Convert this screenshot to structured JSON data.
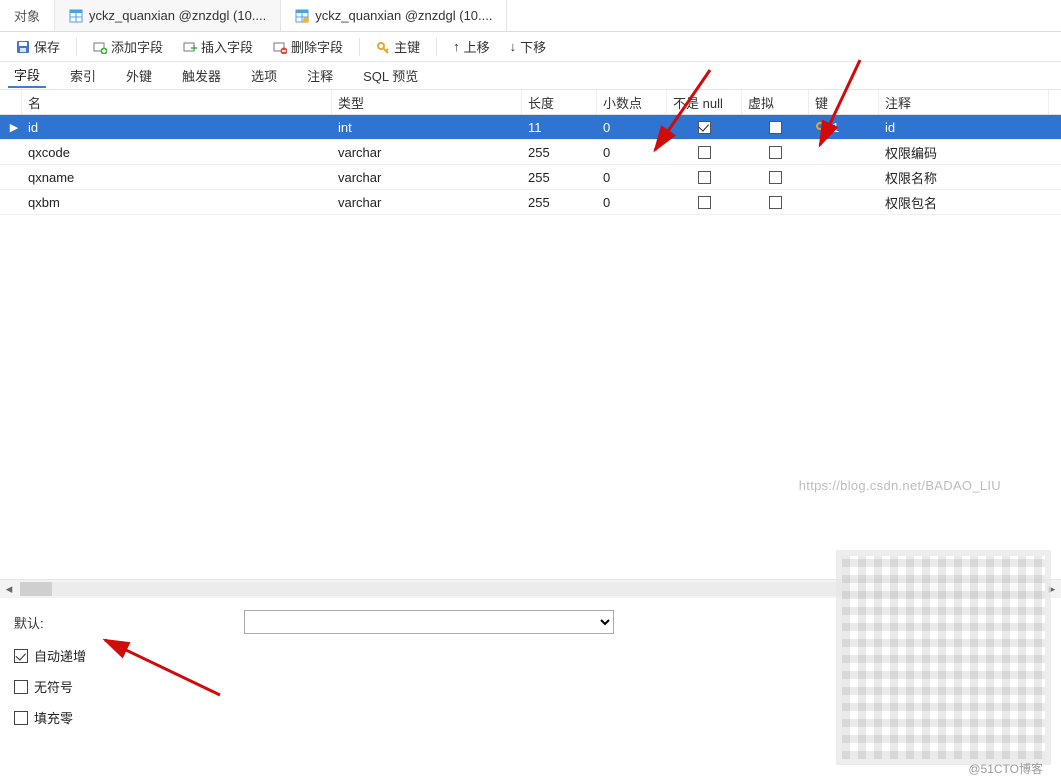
{
  "tabs": {
    "t0": "对象",
    "t1": "yckz_quanxian @znzdgl (10....",
    "t2": "yckz_quanxian @znzdgl (10...."
  },
  "toolbar": {
    "save": "保存",
    "add_field": "添加字段",
    "insert_field": "插入字段",
    "delete_field": "删除字段",
    "primary_key": "主键",
    "move_up": "上移",
    "move_down": "下移"
  },
  "subtabs": {
    "fields": "字段",
    "indexes": "索引",
    "foreign": "外键",
    "triggers": "触发器",
    "options": "选项",
    "comment": "注释",
    "sql": "SQL 预览"
  },
  "columns": {
    "name": "名",
    "type": "类型",
    "length": "长度",
    "decimals": "小数点",
    "not_null": "不是 null",
    "virtual": "虚拟",
    "key": "键",
    "comment": "注释"
  },
  "rows": [
    {
      "name": "id",
      "type": "int",
      "length": "11",
      "decimals": "0",
      "not_null": true,
      "virtual": false,
      "key": "1",
      "comment": "id",
      "selected": true
    },
    {
      "name": "qxcode",
      "type": "varchar",
      "length": "255",
      "decimals": "0",
      "not_null": false,
      "virtual": false,
      "key": "",
      "comment": "权限编码",
      "selected": false
    },
    {
      "name": "qxname",
      "type": "varchar",
      "length": "255",
      "decimals": "0",
      "not_null": false,
      "virtual": false,
      "key": "",
      "comment": "权限名称",
      "selected": false
    },
    {
      "name": "qxbm",
      "type": "varchar",
      "length": "255",
      "decimals": "0",
      "not_null": false,
      "virtual": false,
      "key": "",
      "comment": "权限包名",
      "selected": false
    }
  ],
  "props": {
    "default_label": "默认:",
    "default_value": "",
    "auto_increment": {
      "label": "自动递增",
      "checked": true
    },
    "unsigned": {
      "label": "无符号",
      "checked": false
    },
    "zerofill": {
      "label": "填充零",
      "checked": false
    }
  },
  "watermark": "https://blog.csdn.net/BADAO_LIU",
  "attribution": "@51CTO博客"
}
